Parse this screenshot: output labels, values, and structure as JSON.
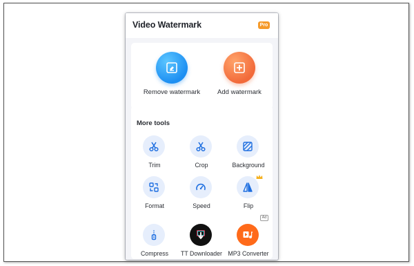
{
  "app": {
    "title": "Video Watermark",
    "pro_badge": "Pro"
  },
  "main_actions": [
    {
      "label": "Remove watermark",
      "icon": "eraser-icon",
      "color": "#1d8ff2"
    },
    {
      "label": "Add watermark",
      "icon": "add-watermark-icon",
      "color": "#f26a3a"
    }
  ],
  "more_tools": {
    "title": "More tools",
    "items": [
      {
        "label": "Trim",
        "icon": "scissors-icon"
      },
      {
        "label": "Crop",
        "icon": "scissors-icon"
      },
      {
        "label": "Background",
        "icon": "background-pattern-icon"
      },
      {
        "label": "Format",
        "icon": "format-icon"
      },
      {
        "label": "Speed",
        "icon": "speedometer-icon"
      },
      {
        "label": "Flip",
        "icon": "flip-icon",
        "premium": true
      },
      {
        "label": "Compress",
        "icon": "zipper-icon"
      },
      {
        "label": "TT Downloader",
        "icon": "tt-downloader-icon"
      },
      {
        "label": "MP3 Converter",
        "icon": "mp3-converter-icon",
        "ad": true
      }
    ]
  },
  "ad_badge": "Ad",
  "colors": {
    "accent": "#1f6fe0",
    "tool_bg": "#e6eefc",
    "pro": "#f59a2a"
  }
}
